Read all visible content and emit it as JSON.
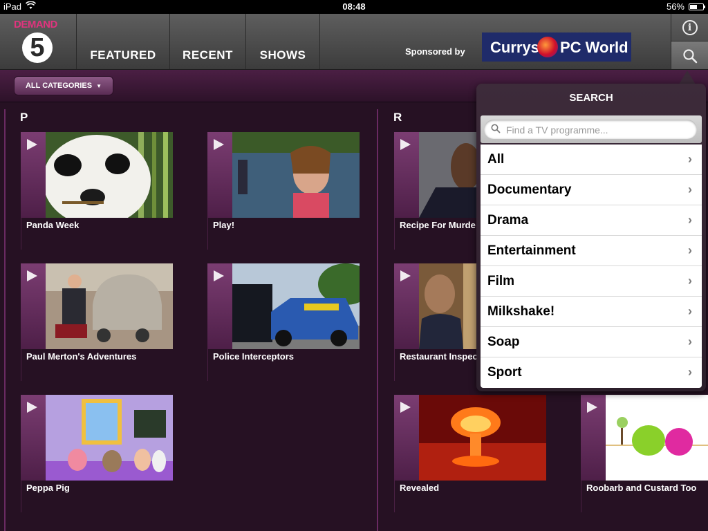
{
  "status_bar": {
    "device": "iPad",
    "time": "08:48",
    "battery": "56%",
    "battery_level": 0.56
  },
  "brand": {
    "demand": "DEMAND",
    "number": "5"
  },
  "nav": {
    "tabs": [
      {
        "label": "FEATURED"
      },
      {
        "label": "RECENT"
      },
      {
        "label": "SHOWS"
      }
    ],
    "sponsored_by": "Sponsored by",
    "sponsor_a": "Currys",
    "sponsor_b": "PC World"
  },
  "filter": {
    "category_button": "ALL CATEGORIES"
  },
  "sections": {
    "p_letter": "P",
    "r_letter": "R"
  },
  "shows": {
    "panda_week": "Panda Week",
    "play": "Play!",
    "recipe_for_murder": "Recipe For Murde",
    "paul_merton": "Paul Merton's Adventures",
    "police_interceptors": "Police Interceptors",
    "restaurant_inspector": "Restaurant Inspec",
    "peppa_pig": "Peppa Pig",
    "revealed": "Revealed",
    "roobarb": "Roobarb and Custard Too"
  },
  "search": {
    "title": "SEARCH",
    "placeholder": "Find a TV programme...",
    "categories": [
      {
        "label": "All"
      },
      {
        "label": "Documentary"
      },
      {
        "label": "Drama"
      },
      {
        "label": "Entertainment"
      },
      {
        "label": "Film"
      },
      {
        "label": "Milkshake!"
      },
      {
        "label": "Soap"
      },
      {
        "label": "Sport"
      }
    ]
  },
  "colors": {
    "accent": "#e0347e",
    "purple": "#4b1f44",
    "sponsor_blue": "#1f2b6a"
  },
  "icons": [
    "wifi-icon",
    "battery-icon",
    "info-icon",
    "search-icon",
    "play-icon",
    "chevron-right-icon",
    "chevron-down-icon"
  ]
}
